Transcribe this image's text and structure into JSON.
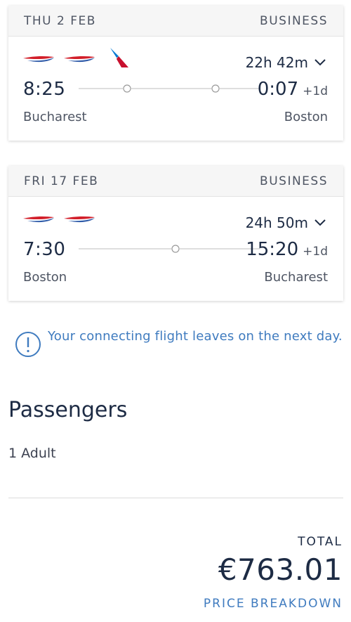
{
  "flights": [
    {
      "date": "THU 2 FEB",
      "cabin": "BUSINESS",
      "airlines": [
        "british-airways",
        "british-airways",
        "american-airlines"
      ],
      "duration": "22h 42m",
      "departure_time": "8:25",
      "arrival_time": "0:07",
      "day_offset": "+1d",
      "origin": "Bucharest",
      "destination": "Boston",
      "stops": 2
    },
    {
      "date": "FRI 17 FEB",
      "cabin": "BUSINESS",
      "airlines": [
        "british-airways",
        "british-airways"
      ],
      "duration": "24h 50m",
      "departure_time": "7:30",
      "arrival_time": "15:20",
      "day_offset": "+1d",
      "origin": "Boston",
      "destination": "Bucharest",
      "stops": 1
    }
  ],
  "notice": {
    "icon": "info-circle-icon",
    "text": "Your connecting flight leaves on the next day."
  },
  "passengers": {
    "title": "Passengers",
    "count_label": "1 Adult"
  },
  "total": {
    "label": "TOTAL",
    "price": "€763.01",
    "breakdown_link": "PRICE BREAKDOWN"
  },
  "colors": {
    "text_dark": "#1d2b44",
    "accent_blue": "#3f7bbf",
    "ba_red": "#d21f2a",
    "ba_blue": "#2f5aa8",
    "aa_red": "#c8102e",
    "aa_blue": "#0078d2"
  }
}
